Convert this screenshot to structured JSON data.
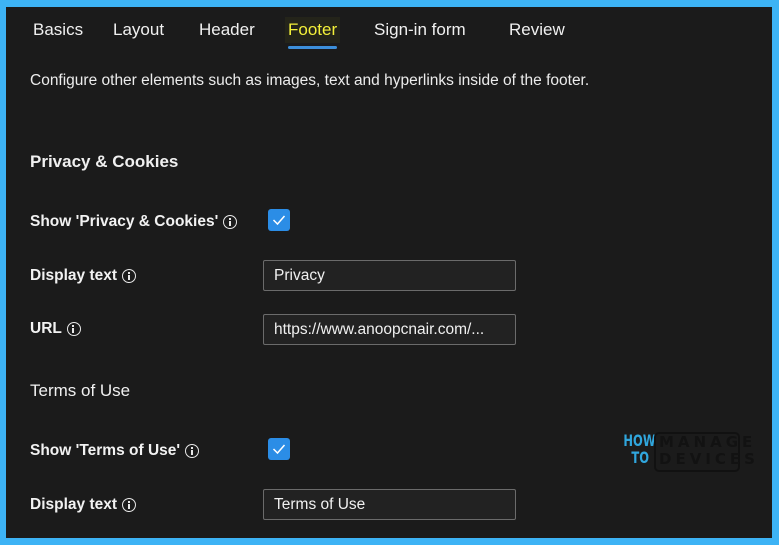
{
  "tabs": [
    {
      "label": "Basics",
      "active": false
    },
    {
      "label": "Layout",
      "active": false
    },
    {
      "label": "Header",
      "active": false
    },
    {
      "label": "Footer",
      "active": true
    },
    {
      "label": "Sign-in form",
      "active": false
    },
    {
      "label": "Review",
      "active": false
    }
  ],
  "description": "Configure other elements such as images, text and hyperlinks inside of the footer.",
  "privacy": {
    "section_title": "Privacy & Cookies",
    "show_label": "Show 'Privacy & Cookies'",
    "show_checked": true,
    "display_text_label": "Display text",
    "display_text_value": "Privacy",
    "url_label": "URL",
    "url_value": "https://www.anoopcnair.com/..."
  },
  "terms": {
    "section_title": "Terms of Use",
    "show_label": "Show 'Terms of Use'",
    "show_checked": true,
    "display_text_label": "Display text",
    "display_text_value": "Terms of Use"
  },
  "watermark": {
    "line1a": "HOW",
    "line1b": "TO",
    "line2a": "MANAGE",
    "line2b": "DEVICES"
  },
  "colors": {
    "frame_border": "#3db3f5",
    "background": "#1b1b1b",
    "accent": "#2b8de6",
    "active_tab_text": "#f3f03a",
    "tab_underline": "#3d8fd9"
  }
}
